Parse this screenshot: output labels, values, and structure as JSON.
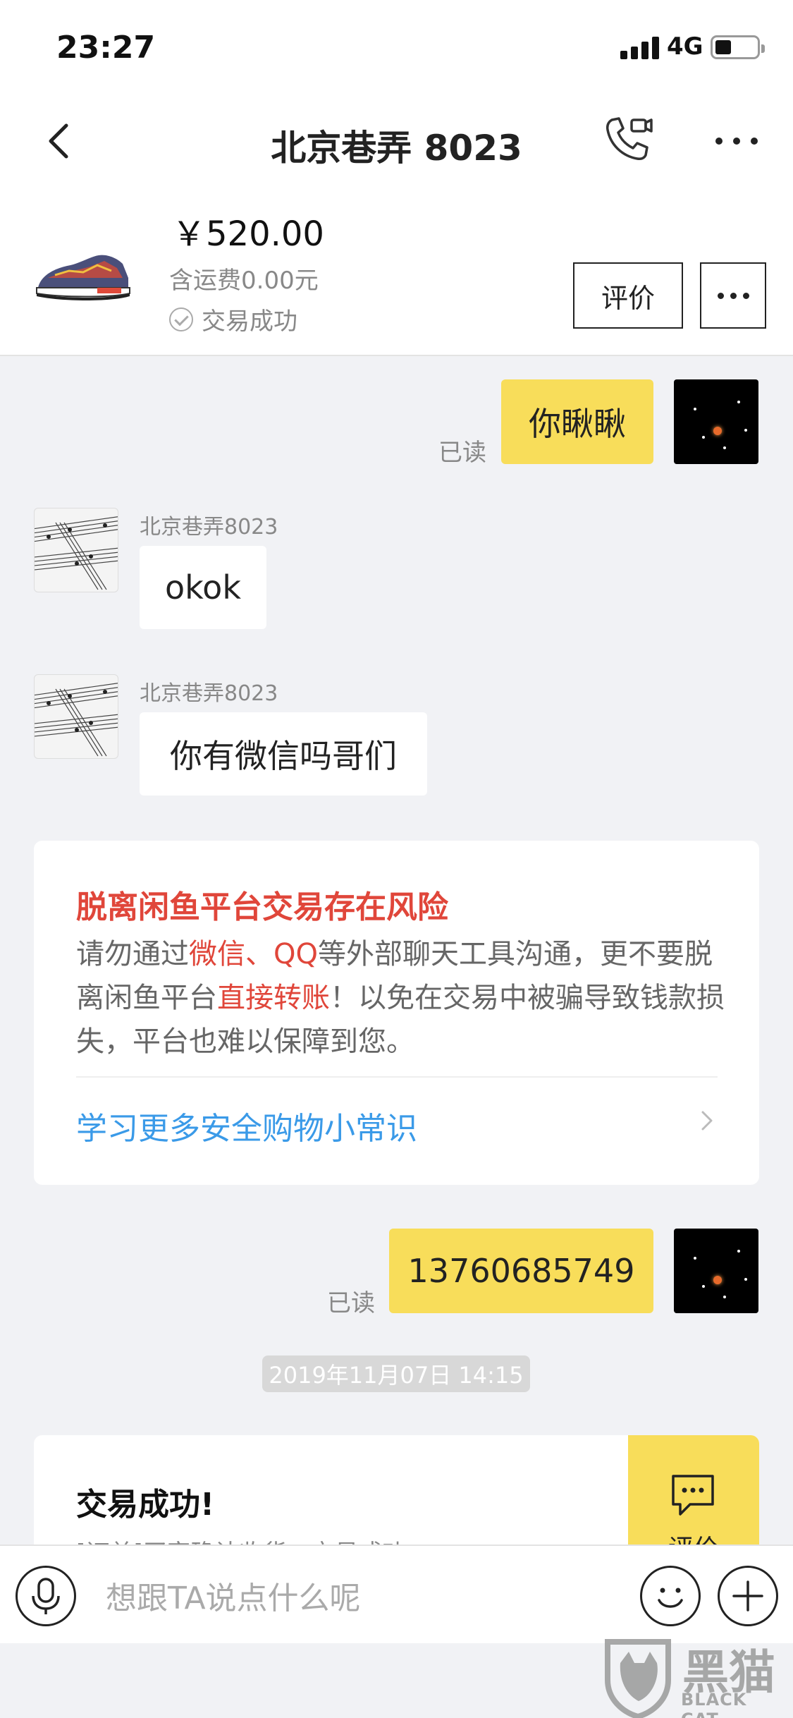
{
  "status_bar": {
    "time": "23:27",
    "network": "4G"
  },
  "nav": {
    "title": "北京巷弄 8023"
  },
  "item": {
    "price": "￥520.00",
    "shipping": "含运费0.00元",
    "status": "交易成功",
    "rate_label": "评价"
  },
  "messages": {
    "m1_read": "已读",
    "m1_text": "你瞅瞅",
    "m2_sender": "北京巷弄8023",
    "m2_text": "okok",
    "m3_sender": "北京巷弄8023",
    "m3_text": "你有微信吗哥们",
    "m4_read": "已读",
    "m4_text": "13760685749"
  },
  "warning": {
    "title": "脱离闲鱼平台交易存在风险",
    "p1": "请勿通过",
    "hl1": "微信、QQ",
    "p2": "等外部聊天工具沟通，更不要脱离闲鱼平台",
    "hl2": "直接转账",
    "p3": "！以免在交易中被骗导致钱款损失，平台也难以保障到您。",
    "link": "学习更多安全购物小常识"
  },
  "timestamp": "2019年11月07日 14:15",
  "trade": {
    "title": "交易成功!",
    "subtitle": "[订单]买家确认收货，交易成功",
    "side_label": "评价"
  },
  "input": {
    "placeholder": "想跟TA说点什么呢"
  },
  "watermark": {
    "text": "黑猫",
    "sub": "BLACK CAT"
  },
  "colors": {
    "accent_yellow": "#f8dd5a",
    "warning_red": "#e0463a",
    "link_blue": "#3a9ae8"
  }
}
